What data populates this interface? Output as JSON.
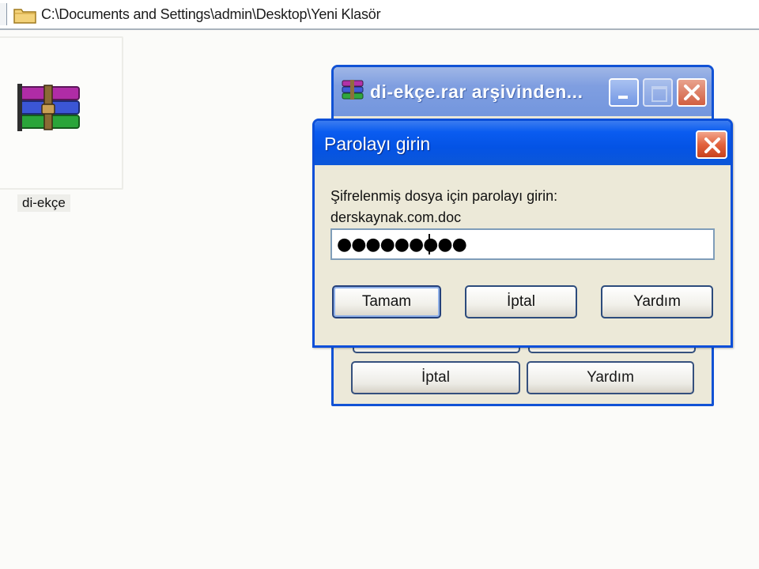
{
  "address_bar": {
    "path": "C:\\Documents and Settings\\admin\\Desktop\\Yeni Klasör",
    "icon": "folder-icon"
  },
  "desktop": {
    "file": {
      "label": "di-ekçe",
      "icon": "winrar-archive-icon"
    }
  },
  "back_window": {
    "title": "di-ekçe.rar arşivinden...",
    "icon": "winrar-icon",
    "buttons": {
      "cancel": "İptal",
      "help": "Yardım"
    }
  },
  "password_dialog": {
    "title": "Parolayı girin",
    "prompt_line1": "Şifrelenmiş dosya için parolayı girin:",
    "prompt_line2": "derskaynak.com.doc",
    "password_value": "●●●●●●●●●",
    "buttons": {
      "ok": "Tamam",
      "cancel": "İptal",
      "help": "Yardım"
    }
  },
  "colors": {
    "title_bar_blue": "#0453e5",
    "close_red": "#e2623d",
    "dialog_face": "#ece9d8"
  }
}
